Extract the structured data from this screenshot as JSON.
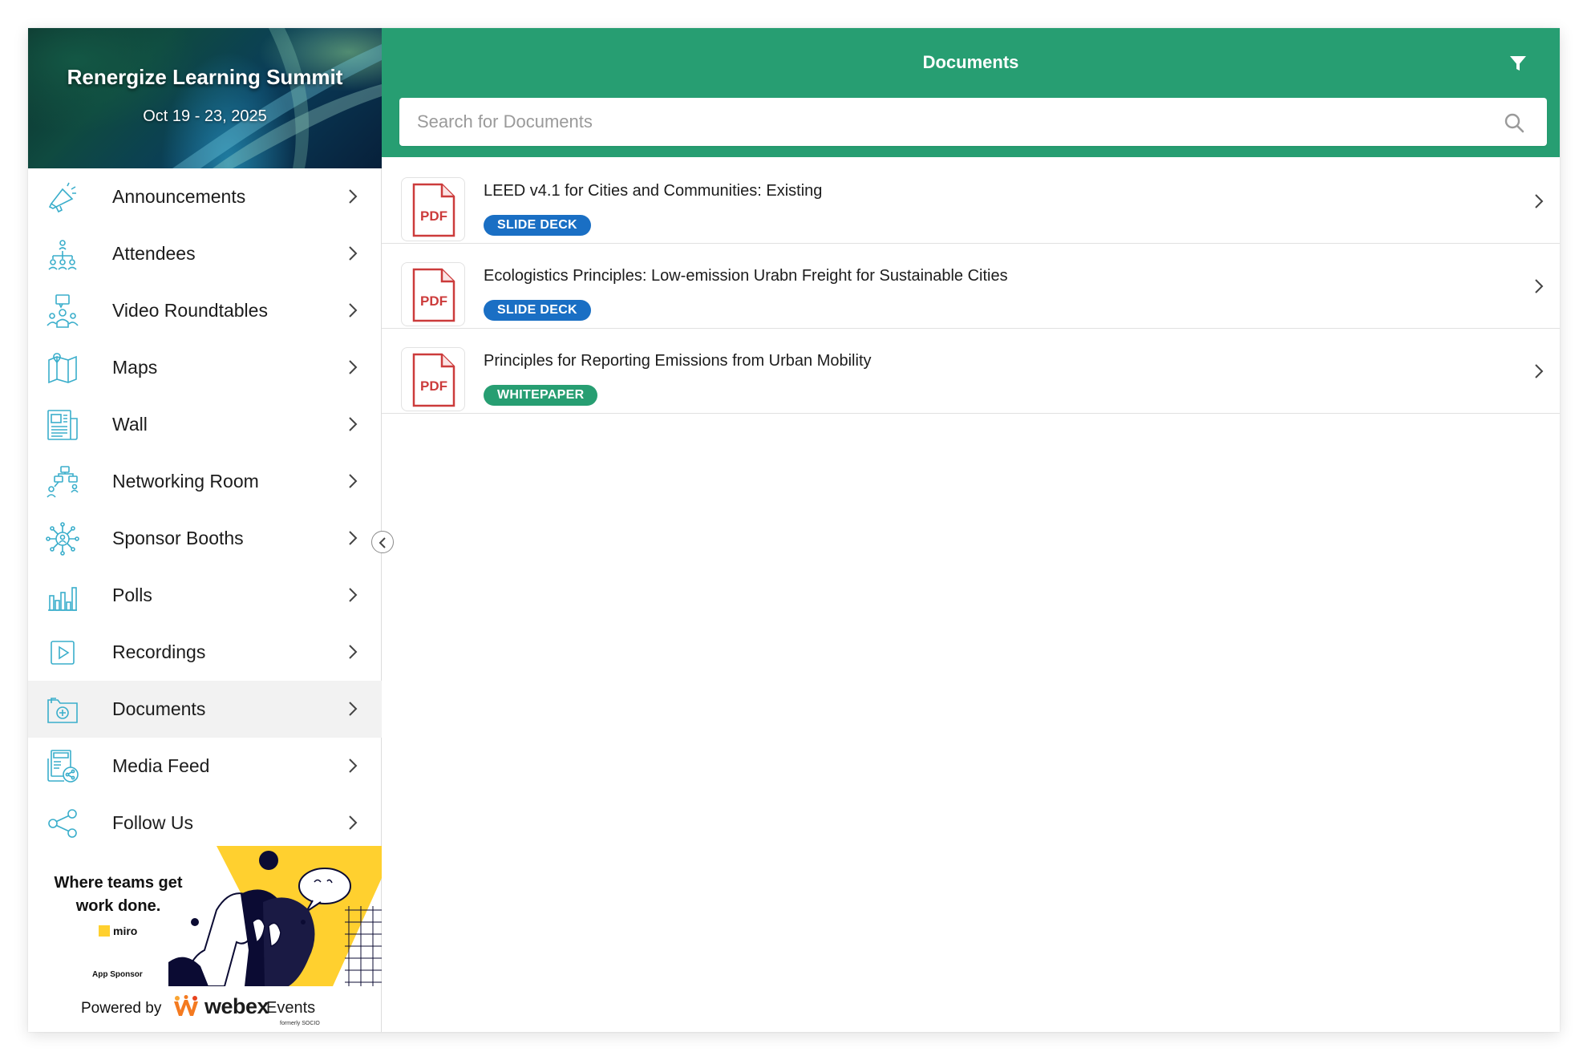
{
  "colors": {
    "primary_green": "#279e72",
    "slide_deck_tag": "#1a6fc4",
    "whitepaper_tag": "#279e72",
    "pdf_red": "#cc3b3b",
    "icon_teal": "#3aaecb"
  },
  "event": {
    "title": "Renergize Learning Summit",
    "dates": "Oct 19 - 23, 2025"
  },
  "sidebar": {
    "items": [
      {
        "label": "Announcements",
        "icon": "megaphone-icon"
      },
      {
        "label": "Attendees",
        "icon": "people-network-icon"
      },
      {
        "label": "Video Roundtables",
        "icon": "video-roundtable-icon"
      },
      {
        "label": "Maps",
        "icon": "map-icon"
      },
      {
        "label": "Wall",
        "icon": "newspaper-wall-icon"
      },
      {
        "label": "Networking Room",
        "icon": "networking-icon"
      },
      {
        "label": "Sponsor Booths",
        "icon": "sponsor-hub-icon"
      },
      {
        "label": "Polls",
        "icon": "bar-chart-icon"
      },
      {
        "label": "Recordings",
        "icon": "play-icon"
      },
      {
        "label": "Documents",
        "icon": "folder-plus-icon",
        "active": true
      },
      {
        "label": "Media Feed",
        "icon": "news-share-icon"
      },
      {
        "label": "Follow Us",
        "icon": "share-icon"
      }
    ],
    "ad": {
      "headline": "Where teams get work done.",
      "brand": "miro",
      "sponsor_label": "App Sponsor"
    },
    "powered_by": {
      "label": "Powered by",
      "brand": "webex",
      "product": "Events",
      "formerly": "formerly SOCIO"
    }
  },
  "main": {
    "title": "Documents",
    "search": {
      "placeholder": "Search for Documents",
      "value": ""
    },
    "documents": [
      {
        "title": "LEED v4.1 for Cities and Communities: Existing",
        "tag": "SLIDE DECK",
        "file_type": "PDF"
      },
      {
        "title": "Ecologistics Principles: Low-emission Urabn Freight for Sustainable Cities",
        "tag": "SLIDE DECK",
        "file_type": "PDF"
      },
      {
        "title": "Principles for Reporting Emissions from Urban Mobility",
        "tag": "WHITEPAPER",
        "file_type": "PDF"
      }
    ]
  }
}
